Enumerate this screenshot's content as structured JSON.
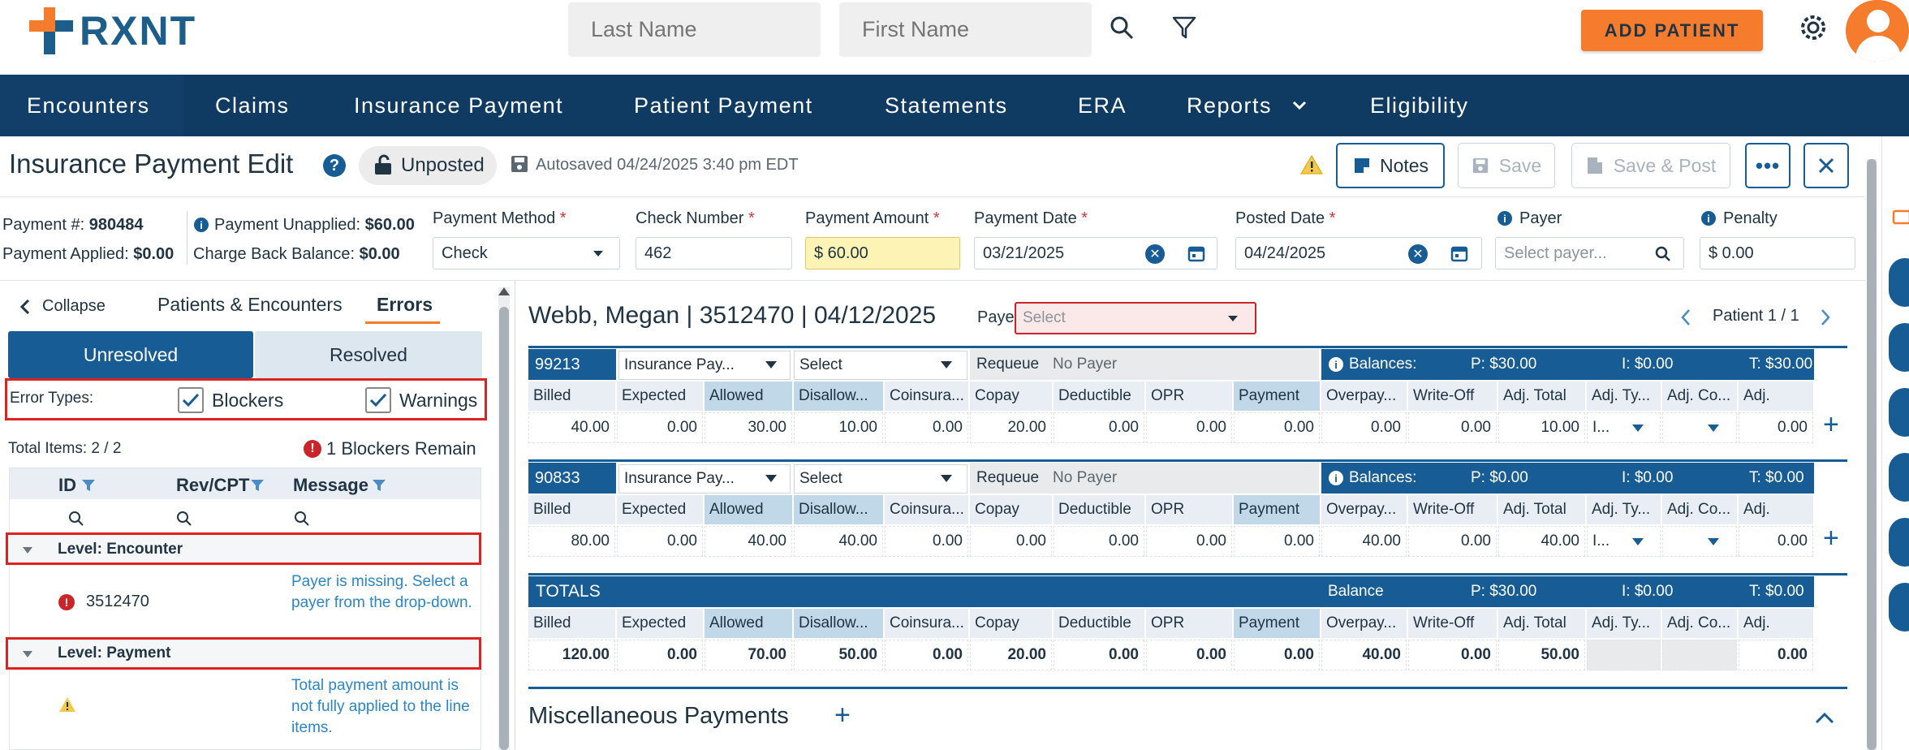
{
  "app": {
    "logo_text": "RXNT"
  },
  "search": {
    "last_name_placeholder": "Last Name",
    "first_name_placeholder": "First Name"
  },
  "header": {
    "add_patient_label": "ADD PATIENT"
  },
  "nav": {
    "items": [
      "Encounters",
      "Claims",
      "Insurance Payment",
      "Patient Payment",
      "Statements",
      "ERA",
      "Reports",
      "Eligibility"
    ]
  },
  "page": {
    "title": "Insurance Payment Edit",
    "status": "Unposted",
    "autosaved": "Autosaved 04/24/2025 3:40 pm EDT",
    "notes_label": "Notes",
    "save_label": "Save",
    "save_post_label": "Save & Post"
  },
  "payment": {
    "number_label": "Payment #:",
    "number_value": "980484",
    "applied_label": "Payment Applied:",
    "applied_value": "$0.00",
    "unapplied_label": "Payment Unapplied:",
    "unapplied_value": "$60.00",
    "chargeback_label": "Charge Back Balance:",
    "chargeback_value": "$0.00",
    "method_label": "Payment Method",
    "method_value": "Check",
    "check_label": "Check Number",
    "check_value": "462",
    "amount_label": "Payment Amount",
    "amount_value": "$ 60.00",
    "date_label": "Payment Date",
    "date_value": "03/21/2025",
    "posted_label": "Posted Date",
    "posted_value": "04/24/2025",
    "payer_label": "Payer",
    "payer_placeholder": "Select payer...",
    "penalty_label": "Penalty",
    "penalty_value": "$ 0.00"
  },
  "left_panel": {
    "collapse_label": "Collapse",
    "tabs": [
      "Patients & Encounters",
      "Errors"
    ],
    "segments": [
      "Unresolved",
      "Resolved"
    ],
    "error_types_label": "Error Types:",
    "blockers_label": "Blockers",
    "warnings_label": "Warnings",
    "total_items": "Total Items: 2 / 2",
    "blockers_remain": "1 Blockers Remain",
    "columns": [
      "ID",
      "Rev/CPT",
      "Message"
    ],
    "groups": [
      {
        "label": "Level: Encounter",
        "id": "3512470",
        "message": "Payer is missing. Select a payer from the drop-down."
      },
      {
        "label": "Level: Payment",
        "id": "",
        "message": "Total payment amount is not fully applied to the line items."
      }
    ]
  },
  "encounter": {
    "title": "Webb, Megan | 3512470 | 04/12/2025",
    "payer_label": "Payer:",
    "payer_placeholder": "Select",
    "pager": "Patient 1 / 1",
    "columns": [
      "Billed",
      "Expected",
      "Allowed",
      "Disallow...",
      "Coinsura...",
      "Copay",
      "Deductible",
      "OPR",
      "Payment",
      "Overpay...",
      "Write-Off",
      "Adj. Total",
      "Adj. Ty...",
      "Adj. Co...",
      "Adj."
    ],
    "lines": [
      {
        "code": "99213",
        "ins_pay": "Insurance Pay...",
        "select": "Select",
        "requeue": "Requeue",
        "no_payer": "No Payer",
        "balances": "Balances:",
        "p": "P: $30.00",
        "i": "I: $0.00",
        "t": "T: $30.00",
        "values": [
          "40.00",
          "0.00",
          "30.00",
          "10.00",
          "0.00",
          "20.00",
          "0.00",
          "0.00",
          "0.00",
          "0.00",
          "0.00",
          "10.00",
          "I...",
          "",
          "0.00"
        ]
      },
      {
        "code": "90833",
        "ins_pay": "Insurance Pay...",
        "select": "Select",
        "requeue": "Requeue",
        "no_payer": "No Payer",
        "balances": "Balances:",
        "p": "P: $0.00",
        "i": "I: $0.00",
        "t": "T: $0.00",
        "values": [
          "80.00",
          "0.00",
          "40.00",
          "40.00",
          "0.00",
          "0.00",
          "0.00",
          "0.00",
          "0.00",
          "40.00",
          "0.00",
          "40.00",
          "I...",
          "",
          "0.00"
        ]
      }
    ],
    "totals": {
      "label": "TOTALS",
      "balance": "Balance",
      "p": "P: $30.00",
      "i": "I: $0.00",
      "t": "T: $0.00",
      "values": [
        "120.00",
        "0.00",
        "70.00",
        "50.00",
        "0.00",
        "20.00",
        "0.00",
        "0.00",
        "0.00",
        "40.00",
        "0.00",
        "50.00",
        "",
        "",
        "0.00"
      ]
    },
    "misc_title": "Miscellaneous Payments"
  }
}
